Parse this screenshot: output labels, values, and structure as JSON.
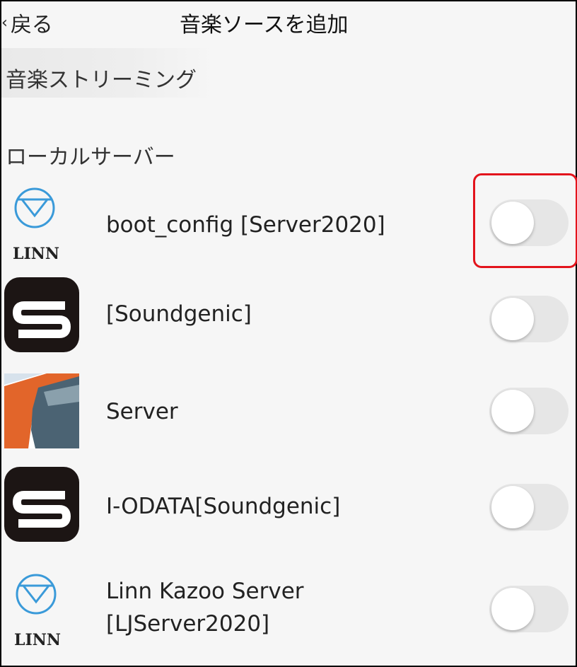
{
  "navbar": {
    "back_chevron": "‹",
    "back_label": "戻る",
    "title": "音楽ソースを追加"
  },
  "sections": {
    "streaming": "音楽ストリーミング",
    "local_servers": "ローカルサーバー"
  },
  "servers": [
    {
      "name_line1": "boot_config [Server2020]",
      "name_line2": "",
      "icon": "linn-logo-icon",
      "icon_text": "LINN",
      "enabled": false,
      "highlighted": true
    },
    {
      "name_line1": "[Soundgenic]",
      "name_line2": "",
      "icon": "soundgenic-logo-icon",
      "icon_text": "",
      "enabled": false,
      "highlighted": false
    },
    {
      "name_line1": "Server",
      "name_line2": "",
      "icon": "server-logo-icon",
      "icon_text": "",
      "enabled": false,
      "highlighted": false
    },
    {
      "name_line1": "I-ODATA[Soundgenic]",
      "name_line2": "",
      "icon": "soundgenic-logo-icon",
      "icon_text": "",
      "enabled": false,
      "highlighted": false
    },
    {
      "name_line1": "Linn Kazoo Server",
      "name_line2": "[LJServer2020]",
      "icon": "linn-logo-icon",
      "icon_text": "LINN",
      "enabled": false,
      "highlighted": false
    }
  ],
  "colors": {
    "background": "#f6f6f6",
    "toggle_off": "#e6e6e6",
    "highlight_border": "#e3141c",
    "linn_blue": "#3a9ad9",
    "soundgenic_bg": "#1c1514"
  }
}
